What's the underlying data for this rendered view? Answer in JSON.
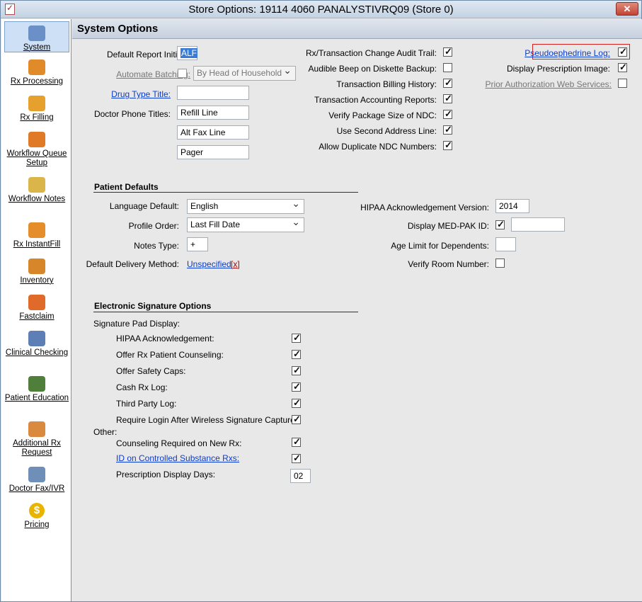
{
  "window": {
    "title": "Store Options: 19114 4060 PANALYSTIVRQ09 (Store 0)",
    "close_label": "✕"
  },
  "sidebar": {
    "items": [
      {
        "label": "System",
        "icon": "computer-icon",
        "color": "#6b8fc7"
      },
      {
        "label": "Rx Processing",
        "icon": "pill-bottle-gear-icon",
        "color": "#e08a2a"
      },
      {
        "label": "Rx Filling",
        "icon": "pill-bottle-icon",
        "color": "#e6a02e"
      },
      {
        "label": "Workflow Queue Setup",
        "icon": "workflow-icon",
        "color": "#e07a26"
      },
      {
        "label": "Workflow Notes",
        "icon": "notepad-icon",
        "color": "#d9b54a"
      },
      {
        "label": "Rx InstantFill",
        "icon": "instantfill-icon",
        "color": "#e58c2b"
      },
      {
        "label": "Inventory",
        "icon": "inventory-icon",
        "color": "#d8862a"
      },
      {
        "label": "Fastclaim",
        "icon": "fastclaim-icon",
        "color": "#e06a2a"
      },
      {
        "label": "Clinical Checking",
        "icon": "clinical-icon",
        "color": "#5d7fb5"
      },
      {
        "label": "Patient Education",
        "icon": "patient-education-icon",
        "color": "#4f7f3b"
      },
      {
        "label": "Additional Rx Request",
        "icon": "additional-rx-icon",
        "color": "#d98a3e"
      },
      {
        "label": "Doctor Fax/IVR",
        "icon": "doctor-fax-icon",
        "color": "#6f8fb8"
      },
      {
        "label": "Pricing",
        "icon": "dollar-coin-icon",
        "color": "#e8b400"
      }
    ]
  },
  "header": {
    "title": "System Options"
  },
  "system": {
    "default_report_initials_label": "Default Report Initials:",
    "default_report_initials_value": "ALF",
    "automate_batching_label": "Automate Batching:",
    "automate_batching_select": "By Head of Household",
    "drug_type_title_label": "Drug Type Title:",
    "drug_type_title_value": "",
    "doctor_phone_titles_label": "Doctor Phone Titles:",
    "phone_title_1": "Refill Line",
    "phone_title_2": "Alt Fax Line",
    "phone_title_3": "Pager",
    "mid_checks": [
      {
        "label": "Rx/Transaction Change Audit Trail:",
        "checked": true
      },
      {
        "label": "Audible Beep on Diskette Backup:",
        "checked": false
      },
      {
        "label": "Transaction Billing History:",
        "checked": true
      },
      {
        "label": "Transaction Accounting Reports:",
        "checked": true
      },
      {
        "label": "Verify Package Size of NDC:",
        "checked": true
      },
      {
        "label": "Use Second Address Line:",
        "checked": true
      },
      {
        "label": "Allow Duplicate NDC Numbers:",
        "checked": true
      }
    ],
    "pseudoephedrine_log_label": "Pseudoephedrine Log:",
    "pseudoephedrine_log_checked": true,
    "display_rx_image_label": "Display Prescription Image:",
    "display_rx_image_checked": true,
    "prior_auth_label": "Prior Authorization Web Services:",
    "prior_auth_checked": false
  },
  "patient_defaults": {
    "section_title": "Patient Defaults",
    "language_label": "Language Default:",
    "language_value": "English",
    "profile_order_label": "Profile Order:",
    "profile_order_value": "Last Fill Date",
    "notes_type_label": "Notes Type:",
    "notes_type_value": "+",
    "delivery_label": "Default Delivery Method:",
    "delivery_value": "Unspecified",
    "delivery_clear": "[x]",
    "hipaa_version_label": "HIPAA Acknowledgement Version:",
    "hipaa_version_value": "2014",
    "med_pak_label": "Display MED-PAK ID:",
    "med_pak_checked": true,
    "med_pak_value": "",
    "age_limit_label": "Age Limit for Dependents:",
    "age_limit_value": "",
    "verify_room_label": "Verify Room Number:",
    "verify_room_checked": false
  },
  "esig": {
    "section_title": "Electronic Signature Options",
    "pad_display_label": "Signature Pad Display:",
    "pad_items": [
      {
        "label": "HIPAA Acknowledgement:",
        "checked": true
      },
      {
        "label": "Offer Rx Patient Counseling:",
        "checked": true
      },
      {
        "label": "Offer Safety Caps:",
        "checked": true
      },
      {
        "label": "Cash Rx Log:",
        "checked": true
      },
      {
        "label": "Third Party Log:",
        "checked": true
      },
      {
        "label": "Require Login After Wireless Signature Capture:",
        "checked": true
      }
    ],
    "other_label": "Other:",
    "counseling_label": "Counseling Required on New Rx:",
    "counseling_checked": true,
    "id_controlled_label": "ID on Controlled Substance Rxs:",
    "id_controlled_checked": true,
    "display_days_label": "Prescription Display Days:",
    "display_days_value": "02"
  }
}
